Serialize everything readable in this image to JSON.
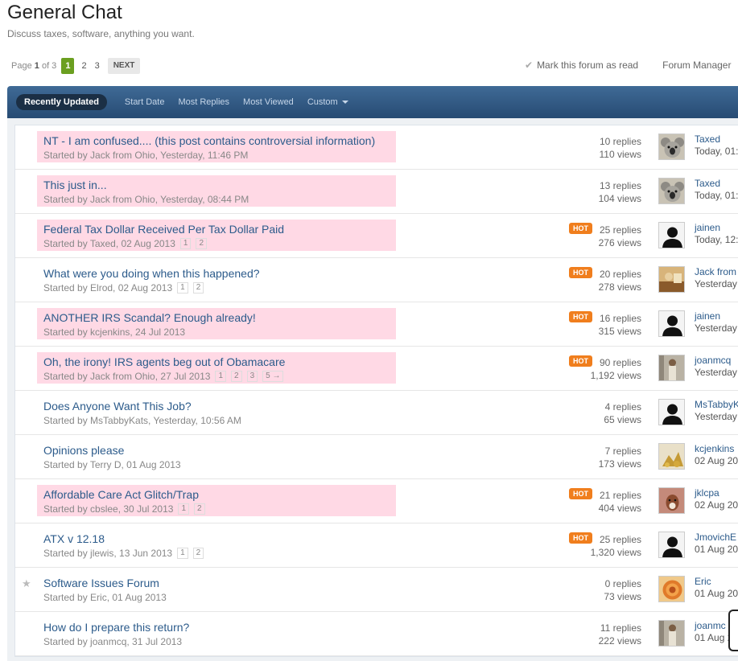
{
  "forum": {
    "title": "General Chat",
    "description": "Discuss taxes, software, anything you want."
  },
  "pagination": {
    "info_prefix": "Page",
    "info_current": "1",
    "info_suffix": "of 3",
    "pages": [
      "1",
      "2",
      "3"
    ],
    "next_label": "NEXT"
  },
  "actions": {
    "mark_read": "Mark this forum as read",
    "manager": "Forum Manager"
  },
  "tabs": [
    "Recently Updated",
    "Start Date",
    "Most Replies",
    "Most Viewed",
    "Custom"
  ],
  "colors": {
    "highlight": "#ffd9e5",
    "hot_badge": "#f07e1d",
    "tab_bar": "#305a85",
    "active_page": "#6b9f20"
  },
  "hot_label": "HOT",
  "topics": [
    {
      "title": "NT - I am confused.... (this post contains controversial information)",
      "meta": "Started by Jack from Ohio, Yesterday, 11:46 PM",
      "pages": [],
      "hot": false,
      "highlight": true,
      "pinned": false,
      "replies": "10 replies",
      "views": "110 views",
      "avatar": "koala",
      "last_user": "Taxed",
      "last_time": "Today, 01:"
    },
    {
      "title": "This just in...",
      "meta": "Started by Jack from Ohio, Yesterday, 08:44 PM",
      "pages": [],
      "hot": false,
      "highlight": true,
      "pinned": false,
      "replies": "13 replies",
      "views": "104 views",
      "avatar": "koala",
      "last_user": "Taxed",
      "last_time": "Today, 01:"
    },
    {
      "title": "Federal Tax Dollar Received Per Tax Dollar Paid",
      "meta": "Started by Taxed, 02 Aug 2013",
      "pages": [
        "1",
        "2"
      ],
      "hot": true,
      "highlight": true,
      "pinned": false,
      "replies": "25 replies",
      "views": "276 views",
      "avatar": "default",
      "last_user": "jainen",
      "last_time": "Today, 12:"
    },
    {
      "title": "What were you doing when this happened?",
      "meta": "Started by Elrod, 02 Aug 2013",
      "pages": [
        "1",
        "2"
      ],
      "hot": true,
      "highlight": false,
      "pinned": false,
      "replies": "20 replies",
      "views": "278 views",
      "avatar": "photo",
      "last_user": "Jack from",
      "last_time": "Yesterday"
    },
    {
      "title": "ANOTHER IRS Scandal? Enough already!",
      "meta": "Started by kcjenkins, 24 Jul 2013",
      "pages": [],
      "hot": true,
      "highlight": true,
      "pinned": false,
      "replies": "16 replies",
      "views": "315 views",
      "avatar": "default",
      "last_user": "jainen",
      "last_time": "Yesterday"
    },
    {
      "title": "Oh, the irony! IRS agents beg out of Obamacare",
      "meta": "Started by Jack from Ohio, 27 Jul 2013",
      "pages": [
        "1",
        "2",
        "3",
        "5 →"
      ],
      "hot": true,
      "highlight": true,
      "pinned": false,
      "replies": "90 replies",
      "views": "1,192 views",
      "avatar": "person",
      "last_user": "joanmcq",
      "last_time": "Yesterday"
    },
    {
      "title": "Does Anyone Want This Job?",
      "meta": "Started by MsTabbyKats, Yesterday, 10:56 AM",
      "pages": [],
      "hot": false,
      "highlight": false,
      "pinned": false,
      "replies": "4 replies",
      "views": "65 views",
      "avatar": "default",
      "last_user": "MsTabbyK",
      "last_time": "Yesterday"
    },
    {
      "title": "Opinions please",
      "meta": "Started by Terry D, 01 Aug 2013",
      "pages": [],
      "hot": false,
      "highlight": false,
      "pinned": false,
      "replies": "7 replies",
      "views": "173 views",
      "avatar": "gold",
      "last_user": "kcjenkins",
      "last_time": "02 Aug 20"
    },
    {
      "title": "Affordable Care Act Glitch/Trap",
      "meta": "Started by cbslee, 30 Jul 2013",
      "pages": [
        "1",
        "2"
      ],
      "hot": true,
      "highlight": true,
      "pinned": false,
      "replies": "21 replies",
      "views": "404 views",
      "avatar": "dog",
      "last_user": "jklcpa",
      "last_time": "02 Aug 20"
    },
    {
      "title": "ATX v 12.18",
      "meta": "Started by jlewis, 13 Jun 2013",
      "pages": [
        "1",
        "2"
      ],
      "hot": true,
      "highlight": false,
      "pinned": false,
      "replies": "25 replies",
      "views": "1,320 views",
      "avatar": "default",
      "last_user": "JmovichE",
      "last_time": "01 Aug 20"
    },
    {
      "title": "Software Issues Forum",
      "meta": "Started by Eric, 01 Aug 2013",
      "pages": [],
      "hot": false,
      "highlight": false,
      "pinned": true,
      "replies": "0 replies",
      "views": "73 views",
      "avatar": "shell",
      "last_user": "Eric",
      "last_time": "01 Aug 20"
    },
    {
      "title": "How do I prepare this return?",
      "meta": "Started by joanmcq, 31 Jul 2013",
      "pages": [],
      "hot": false,
      "highlight": false,
      "pinned": false,
      "replies": "11 replies",
      "views": "222 views",
      "avatar": "person",
      "last_user": "joanmc",
      "last_time": "01 Aug 2"
    }
  ]
}
